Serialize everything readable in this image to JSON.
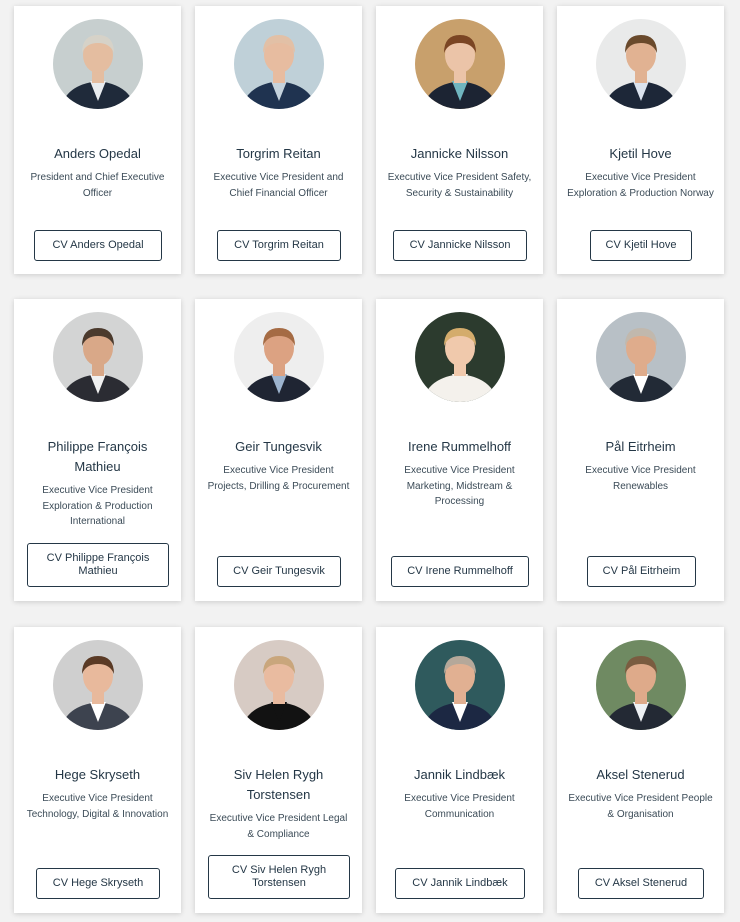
{
  "people": [
    {
      "name": "Anders Opedal",
      "role": "President and Chief Executive Officer",
      "cv": "CV Anders Opedal",
      "avatar": "portrait-photo",
      "colors": {
        "bg": "#c7cfcf",
        "hair": "#d6d2c8",
        "skin": "#e4bda0",
        "suit": "#1f2a3a",
        "shirt": "#e9ecef"
      }
    },
    {
      "name": "Torgrim Reitan",
      "role": "Executive Vice President and Chief Financial Officer",
      "cv": "CV Torgrim Reitan",
      "avatar": "portrait-photo",
      "colors": {
        "bg": "#bfd0d8",
        "hair": "#e2c0a6",
        "skin": "#e7bca0",
        "suit": "#1f3350",
        "shirt": "#c4d2dc"
      }
    },
    {
      "name": "Jannicke Nilsson",
      "role": "Executive Vice President Safety, Security & Sustainability",
      "cv": "CV Jannicke Nilsson",
      "avatar": "portrait-photo",
      "colors": {
        "bg": "#c8a06c",
        "hair": "#7a4524",
        "skin": "#ebc4a8",
        "suit": "#1c2433",
        "shirt": "#6fb5bf"
      }
    },
    {
      "name": "Kjetil Hove",
      "role": "Executive Vice President Exploration & Production Norway",
      "cv": "CV Kjetil Hove",
      "avatar": "portrait-photo",
      "colors": {
        "bg": "#e9eaea",
        "hair": "#6a4a2c",
        "skin": "#e1b292",
        "suit": "#1d2738",
        "shirt": "#dbe3ee"
      }
    },
    {
      "name": "Philippe François Mathieu",
      "role": "Executive Vice President Exploration & Production International",
      "cv": "CV Philippe François Mathieu",
      "avatar": "portrait-photo",
      "colors": {
        "bg": "#d3d4d4",
        "hair": "#4b3a2d",
        "skin": "#d9a888",
        "suit": "#2b2c33",
        "shirt": "#f0f0f0"
      }
    },
    {
      "name": "Geir Tungesvik",
      "role": "Executive Vice President Projects, Drilling & Procurement",
      "cv": "CV Geir Tungesvik",
      "avatar": "portrait-photo",
      "colors": {
        "bg": "#eeeeee",
        "hair": "#a56b44",
        "skin": "#dca282",
        "suit": "#1f2533",
        "shirt": "#9db4cf"
      }
    },
    {
      "name": "Irene Rummelhoff",
      "role": "Executive Vice President Marketing, Midstream & Processing",
      "cv": "CV Irene Rummelhoff",
      "avatar": "portrait-photo",
      "colors": {
        "bg": "#2c3b2e",
        "hair": "#d4ac6c",
        "skin": "#f0c9ac",
        "suit": "#f4f1ec",
        "shirt": "#f4f1ec"
      }
    },
    {
      "name": "Pål Eitrheim",
      "role": "Executive Vice President Renewables",
      "cv": "CV Pål Eitrheim",
      "avatar": "portrait-photo",
      "colors": {
        "bg": "#b8c0c6",
        "hair": "#c1b8ad",
        "skin": "#dfac8c",
        "suit": "#222a36",
        "shirt": "#ffffff"
      }
    },
    {
      "name": "Hege Skryseth",
      "role": "Executive Vice President Technology, Digital & Innovation",
      "cv": "CV Hege Skryseth",
      "avatar": "portrait-photo",
      "colors": {
        "bg": "#cfcfcf",
        "hair": "#5a3a25",
        "skin": "#e8b99c",
        "suit": "#3d434f",
        "shirt": "#ffffff"
      }
    },
    {
      "name": "Siv Helen Rygh Torstensen",
      "role": "Executive Vice President Legal & Compliance",
      "cv": "CV Siv Helen Rygh Torstensen",
      "avatar": "portrait-photo",
      "colors": {
        "bg": "#d7cbc4",
        "hair": "#c9a67c",
        "skin": "#e9bba0",
        "suit": "#121212",
        "shirt": "#121212"
      }
    },
    {
      "name": "Jannik Lindbæk",
      "role": "Executive Vice President Communication",
      "cv": "CV Jannik Lindbæk",
      "avatar": "portrait-photo",
      "colors": {
        "bg": "#2f5a5d",
        "hair": "#b5a89a",
        "skin": "#e1b092",
        "suit": "#1c2843",
        "shirt": "#ffffff"
      }
    },
    {
      "name": "Aksel Stenerud",
      "role": "Executive Vice President People & Organisation",
      "cv": "CV Aksel Stenerud",
      "avatar": "portrait-photo",
      "colors": {
        "bg": "#6f8a62",
        "hair": "#7a5c40",
        "skin": "#deaa8a",
        "suit": "#232934",
        "shirt": "#eef1f4"
      }
    }
  ],
  "theme": {
    "text": "#243746",
    "card": "#ffffff",
    "page": "#f2f2f2"
  }
}
